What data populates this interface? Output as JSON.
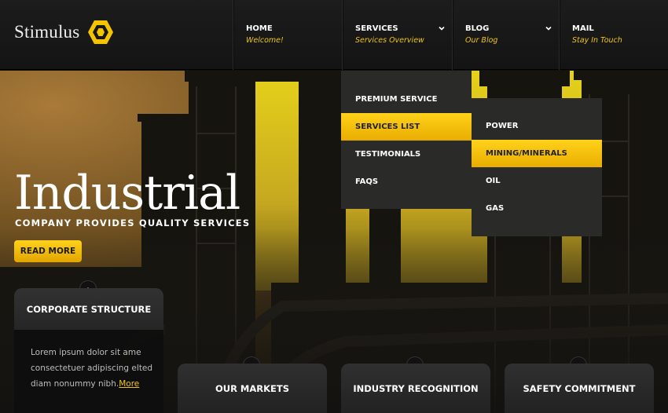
{
  "brand": {
    "name": "Stimulus"
  },
  "nav": [
    {
      "label": "HOME",
      "sub": "Welcome!"
    },
    {
      "label": "SERVICES",
      "sub": "Services Overview"
    },
    {
      "label": "BLOG",
      "sub": "Our Blog"
    },
    {
      "label": "MAIL",
      "sub": "Stay In Touch"
    }
  ],
  "services_menu": {
    "items": [
      "PREMIUM SERVICE",
      "SERVICES LIST",
      "TESTIMONIALS",
      "FAQS"
    ],
    "active": "SERVICES LIST",
    "submenu": {
      "items": [
        "POWER",
        "MINING/MINERALS",
        "OIL",
        "GAS"
      ],
      "active": "MINING/MINERALS"
    }
  },
  "hero": {
    "title": "Industrial",
    "subtitle": "COMPANY PROVIDES QUALITY SERVICES",
    "button": "READ MORE"
  },
  "corporate": {
    "heading": "CORPORATE STRUCTURE",
    "text": "Lorem ipsum dolor sit ame consectetuer adipiscing elted diam nonummy nibh.",
    "more_link": "More"
  },
  "tabs": [
    "OUR MARKETS",
    "INDUSTRY RECOGNITION",
    "SAFETY COMMITMENT"
  ],
  "colors": {
    "accent": "#f0c419",
    "header_bg": "#181818",
    "panel_bg": "#2a2a28"
  },
  "icons": {
    "logo": "hexagon-logo-icon",
    "dropdown": "chevron-down-icon",
    "expand": "chevron-up-icon"
  }
}
